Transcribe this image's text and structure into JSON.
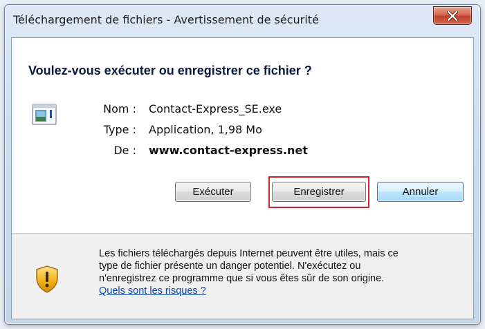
{
  "window": {
    "title": "Téléchargement de fichiers - Avertissement de sécurité",
    "close_icon": "close-icon",
    "close_color": "#c0402a"
  },
  "dialog": {
    "question": "Voulez-vous exécuter ou enregistrer ce fichier ?",
    "file_icon": "application-file-icon",
    "fields": [
      {
        "label": "Nom :",
        "value": "Contact-Express_SE.exe"
      },
      {
        "label": "Type :",
        "value": "Application, 1,98 Mo"
      },
      {
        "label": "De :",
        "value": "www.contact-express.net"
      }
    ]
  },
  "buttons": {
    "run_label": "Exécuter",
    "save_label": "Enregistrer",
    "cancel_label": "Annuler",
    "highlight_color": "#d2232a"
  },
  "footer": {
    "shield_icon": "warning-shield-icon",
    "warning_lines": [
      "Les fichiers téléchargés depuis Internet peuvent être utiles, mais ce",
      "type de fichier présente un danger potentiel. N'exécutez ou",
      "n'enregistrez ce programme que si vous êtes sûr de son origine."
    ],
    "risk_link": "Quels sont les risques ?"
  }
}
